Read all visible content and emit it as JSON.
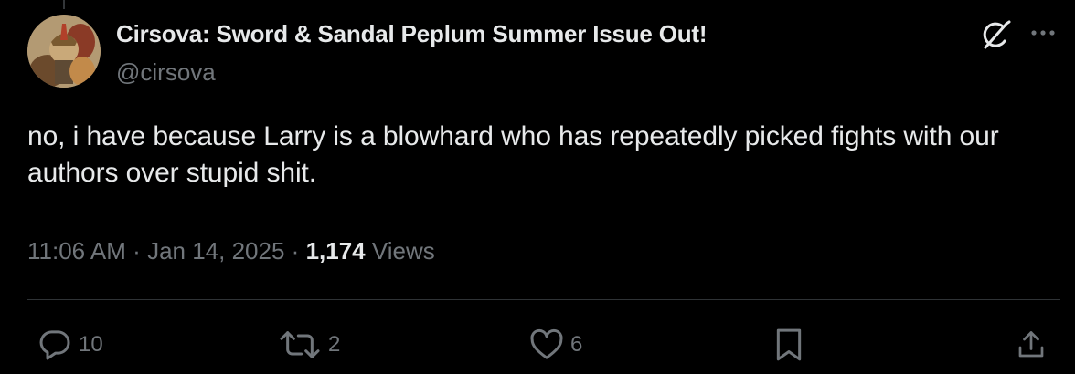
{
  "author": {
    "display_name": "Cirsova: Sword & Sandal Peplum Summer Issue Out!",
    "handle": "@cirsova"
  },
  "tweet": {
    "text": "no, i have because Larry is a blowhard who has repeatedly picked fights with our authors over stupid shit.",
    "time": "11:06 AM",
    "separator": "·",
    "date": "Jan 14, 2025",
    "views_count": "1,174",
    "views_label": "Views"
  },
  "actions": {
    "replies": "10",
    "reposts": "2",
    "likes": "6"
  },
  "icons": {
    "header": [
      "grok-icon",
      "more-icon"
    ],
    "actions": [
      "reply-icon",
      "repost-icon",
      "like-icon",
      "bookmark-icon",
      "share-icon"
    ]
  },
  "colors": {
    "background": "#000000",
    "text_primary": "#e7e9ea",
    "text_secondary": "#71767b",
    "divider": "#2f3336"
  }
}
